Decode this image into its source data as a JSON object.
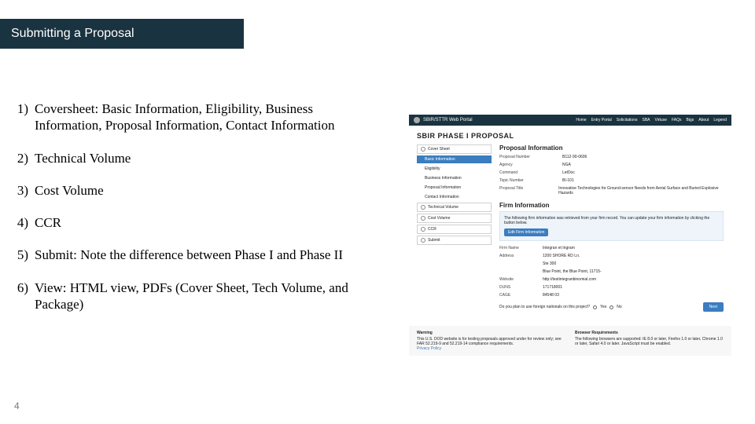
{
  "title": "Submitting a Proposal",
  "page_number": "4",
  "items": [
    {
      "num": "1)",
      "text": "Coversheet: Basic Information, Eligibility, Business Information, Proposal Information, Contact Information"
    },
    {
      "num": "2)",
      "text": "Technical Volume"
    },
    {
      "num": "3)",
      "text": "Cost Volume"
    },
    {
      "num": "4)",
      "text": "CCR"
    },
    {
      "num": "5)",
      "text": "Submit: Note the difference between Phase I and Phase II"
    },
    {
      "num": "6)",
      "text": "View: HTML view, PDFs (Cover Sheet, Tech Volume, and Package)"
    }
  ],
  "portal": {
    "brand": "SBIR/STTR Web Portal",
    "nav": [
      "Home",
      "Entry Portal",
      "Solicitations",
      "SBA",
      "Virtuse",
      "FAQs",
      "Bigs",
      "About",
      "Legend"
    ],
    "page_title": "SBIR PHASE I PROPOSAL",
    "steps": {
      "cover": "Cover Sheet",
      "basic": "Basic Information",
      "eligibility": "Eligibility",
      "business": "Business Information",
      "proposal": "Proposal Information",
      "contact": "Contact Information",
      "tech": "Technical Volume",
      "cost": "Cost Volume",
      "ccr": "CCR",
      "submit": "Submit"
    },
    "section_title": "Proposal Information",
    "fields": {
      "prop_num": {
        "label": "Proposal Number",
        "value": "B112-90-0606"
      },
      "agency": {
        "label": "Agency",
        "value": "NGA"
      },
      "command": {
        "label": "Command",
        "value": "LetDoc"
      },
      "topic": {
        "label": "Topic Number",
        "value": "BI-101"
      },
      "ptitle": {
        "label": "Proposal Title",
        "value": "Innovative Technologies for Ground-sensor Needs from Aerial Surface and Buried Explosive Hazards"
      }
    },
    "firm_title": "Firm Information",
    "firm_note": "The following firm information was retrieved from your firm record. You can update your firm information by clicking the button below.",
    "edit_btn": "Edit Firm Information",
    "firm": {
      "name": {
        "label": "Firm Name",
        "value": "Integran et Ingram"
      },
      "addr": {
        "label": "Address",
        "value": "1200 SHORE RD Ln."
      },
      "suite": {
        "label": "",
        "value": "Ste 300"
      },
      "city": {
        "label": "",
        "value": "Blue Point, the Blue Point, 11715-"
      },
      "web": {
        "label": "Website",
        "value": "http://testintegranbinomial.com"
      },
      "duns": {
        "label": "DUNS",
        "value": "171718001"
      },
      "cage": {
        "label": "CAGE",
        "value": "84548 03"
      }
    },
    "itar_q": "Do you plan to use foreign nationals on this project?",
    "yes": "Yes",
    "no": "No",
    "next": "Next",
    "footer": {
      "warn_t": "Warning",
      "warn": "This U.S. DOD website is for testing proposals approved under for review only; see FAR 52.219-9 and 52.219-14 compliance requirements.",
      "priv": "Privacy Policy",
      "req_t": "Browser Requirements",
      "req": "The following browsers are supported: IE 8.0 or later, Firefox 1.0 or later, Chrome 1.0 or later, Safari 4.0 or later. JavaScript must be enabled."
    }
  }
}
